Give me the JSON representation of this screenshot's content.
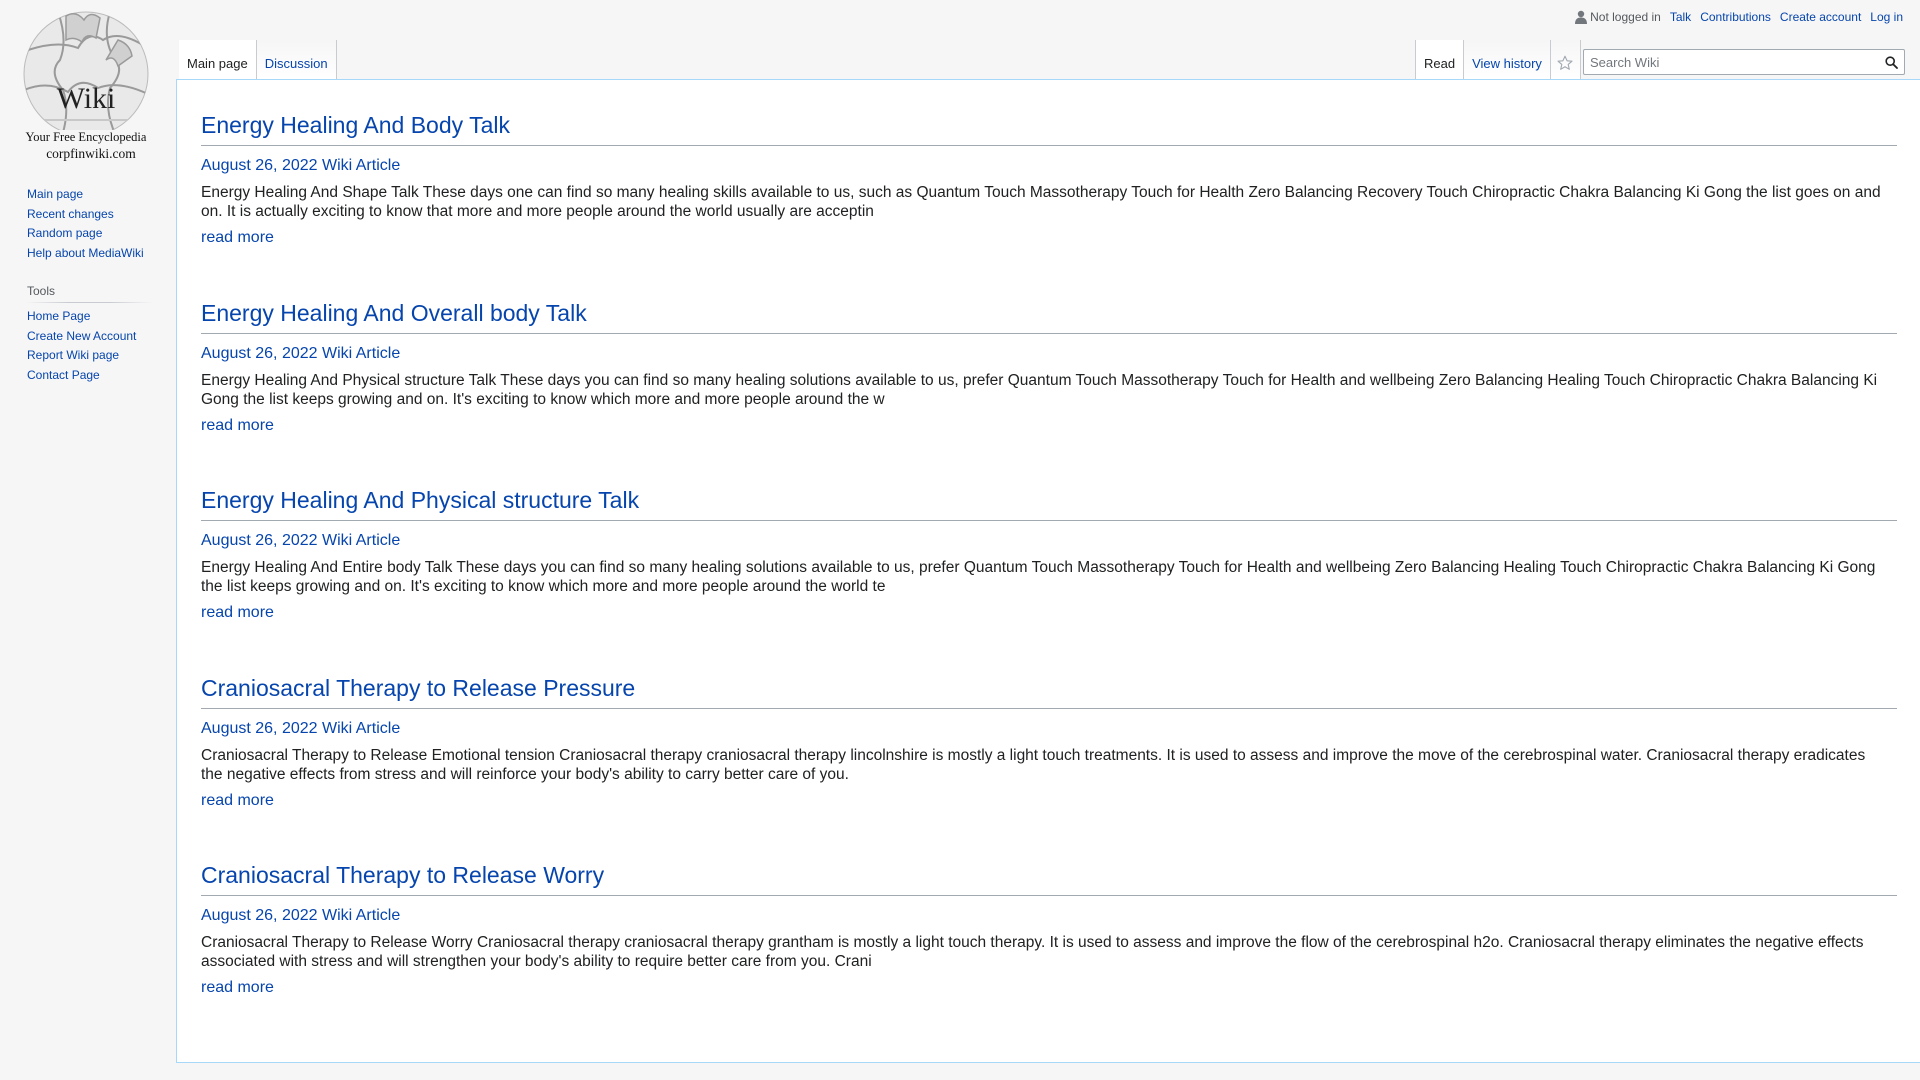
{
  "logo": {
    "word": "Wiki",
    "tagline": "Your Free Encyclopedia",
    "domain": "corpfinwiki.com"
  },
  "personal": {
    "status": "Not logged in",
    "links": [
      "Talk",
      "Contributions",
      "Create account",
      "Log in"
    ]
  },
  "tabs": {
    "left": [
      "Main page",
      "Discussion"
    ],
    "right": [
      "Read",
      "View history"
    ]
  },
  "search": {
    "placeholder": "Search Wiki",
    "value": ""
  },
  "sidebar": {
    "navigation": [
      "Main page",
      "Recent changes",
      "Random page",
      "Help about MediaWiki"
    ],
    "tools_heading": "Tools",
    "tools": [
      "Home Page",
      "Create New Account",
      "Report Wiki page",
      "Contact Page"
    ]
  },
  "articles": [
    {
      "title": "Energy Healing And Body Talk",
      "meta": "August 26, 2022 Wiki Article",
      "excerpt": "Energy Healing And Shape Talk These days one can find so many healing skills available to us, such as Quantum Touch Massotherapy Touch for Health Zero Balancing Recovery Touch Chiropractic Chakra Balancing Ki Gong the list goes on and on. It is actually exciting to know that more and more people around the world usually are acceptin",
      "readmore": "read more"
    },
    {
      "title": "Energy Healing And Overall body Talk",
      "meta": "August 26, 2022 Wiki Article",
      "excerpt": "Energy Healing And Physical structure Talk These days you can find so many healing solutions available to us, prefer Quantum Touch Massotherapy Touch for Health and wellbeing Zero Balancing Healing Touch Chiropractic Chakra Balancing Ki Gong the list keeps growing and on. It's exciting to know which more and more people around the w",
      "readmore": "read more"
    },
    {
      "title": "Energy Healing And Physical structure Talk",
      "meta": "August 26, 2022 Wiki Article",
      "excerpt": "Energy Healing And Entire body Talk These days you can find so many healing solutions available to us, prefer Quantum Touch Massotherapy Touch for Health and wellbeing Zero Balancing Healing Touch Chiropractic Chakra Balancing Ki Gong the list keeps growing and on. It's exciting to know which more and more people around the world te",
      "readmore": "read more"
    },
    {
      "title": "Craniosacral Therapy to Release Pressure",
      "meta": "August 26, 2022 Wiki Article",
      "excerpt": "Craniosacral Therapy to Release Emotional tension Craniosacral therapy craniosacral therapy lincolnshire is mostly a light touch treatments. It is used to assess and improve the move of the cerebrospinal water. Craniosacral therapy eradicates the negative effects from stress and will reinforce your body's ability to carry better care of you.",
      "readmore": "read more"
    },
    {
      "title": "Craniosacral Therapy to Release Worry",
      "meta": "August 26, 2022 Wiki Article",
      "excerpt": "Craniosacral Therapy to Release Worry Craniosacral therapy craniosacral therapy grantham is mostly a light touch therapy. It is used to assess and improve the flow of the cerebrospinal h2o. Craniosacral therapy eliminates the negative effects associated with stress and will strengthen your body's ability to require better care from you. Crani",
      "readmore": "read more"
    }
  ]
}
